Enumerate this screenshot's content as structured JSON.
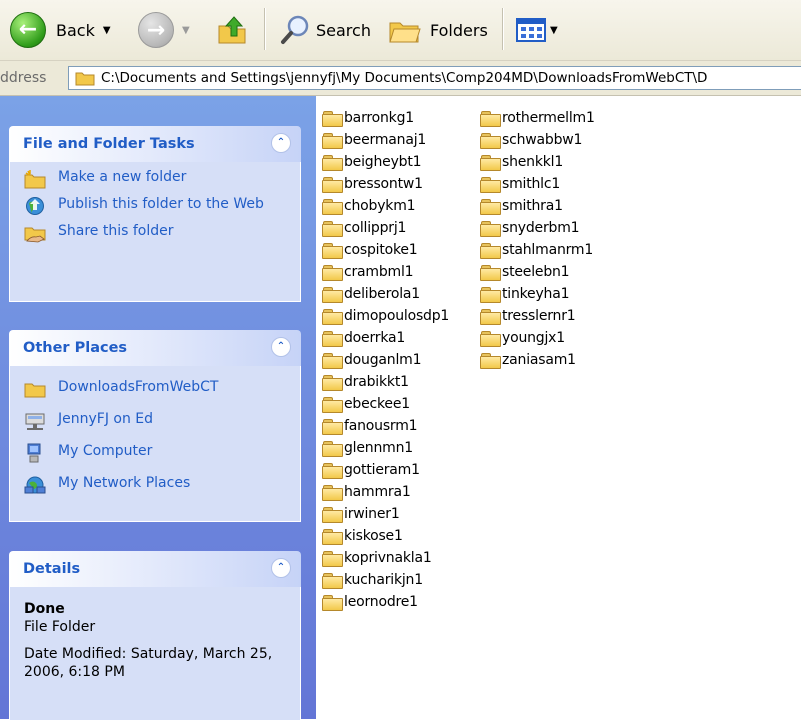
{
  "toolbar": {
    "back_label": "Back",
    "search_label": "Search",
    "folders_label": "Folders"
  },
  "address": {
    "label": "ddress",
    "path": "C:\\Documents and Settings\\jennyfj\\My Documents\\Comp204MD\\DownloadsFromWebCT\\D"
  },
  "task_panels": {
    "file_folder_tasks": {
      "title": "File and Folder Tasks",
      "items": [
        {
          "label": "Make a new folder",
          "icon": "new-folder-icon"
        },
        {
          "label": "Publish this folder to the Web",
          "icon": "publish-web-icon"
        },
        {
          "label": "Share this folder",
          "icon": "share-folder-icon"
        }
      ]
    },
    "other_places": {
      "title": "Other Places",
      "items": [
        {
          "label": "DownloadsFromWebCT",
          "icon": "folder-icon"
        },
        {
          "label": "JennyFJ on Ed",
          "icon": "network-drive-icon"
        },
        {
          "label": "My Computer",
          "icon": "my-computer-icon"
        },
        {
          "label": "My Network Places",
          "icon": "network-places-icon"
        }
      ]
    },
    "details": {
      "title": "Details",
      "name": "Done",
      "type": "File Folder",
      "modified": "Date Modified: Saturday, March 25, 2006, 6:18 PM"
    }
  },
  "files": {
    "column1": [
      "barronkg1",
      "beermanaj1",
      "beigheybt1",
      "bressontw1",
      "chobykm1",
      "collipprj1",
      "cospitoke1",
      "crambml1",
      "deliberola1",
      "dimopoulosdp1",
      "doerrka1",
      "douganlm1",
      "drabikkt1",
      "ebeckee1",
      "fanousrm1",
      "glennmn1",
      "gottieram1",
      "hammra1",
      "irwiner1",
      "kiskose1",
      "koprivnakla1",
      "kucharikjn1",
      "leornodre1"
    ],
    "column2": [
      "rothermellm1",
      "schwabbw1",
      "shenkkl1",
      "smithlc1",
      "smithra1",
      "snyderbm1",
      "stahlmanrm1",
      "steelebn1",
      "tinkeyha1",
      "tresslernr1",
      "youngjx1",
      "zaniasam1"
    ]
  },
  "colors": {
    "taskpane_bg": "#6f8fe0",
    "panel_title": "#215dc6",
    "panel_body": "#d6dff7"
  }
}
